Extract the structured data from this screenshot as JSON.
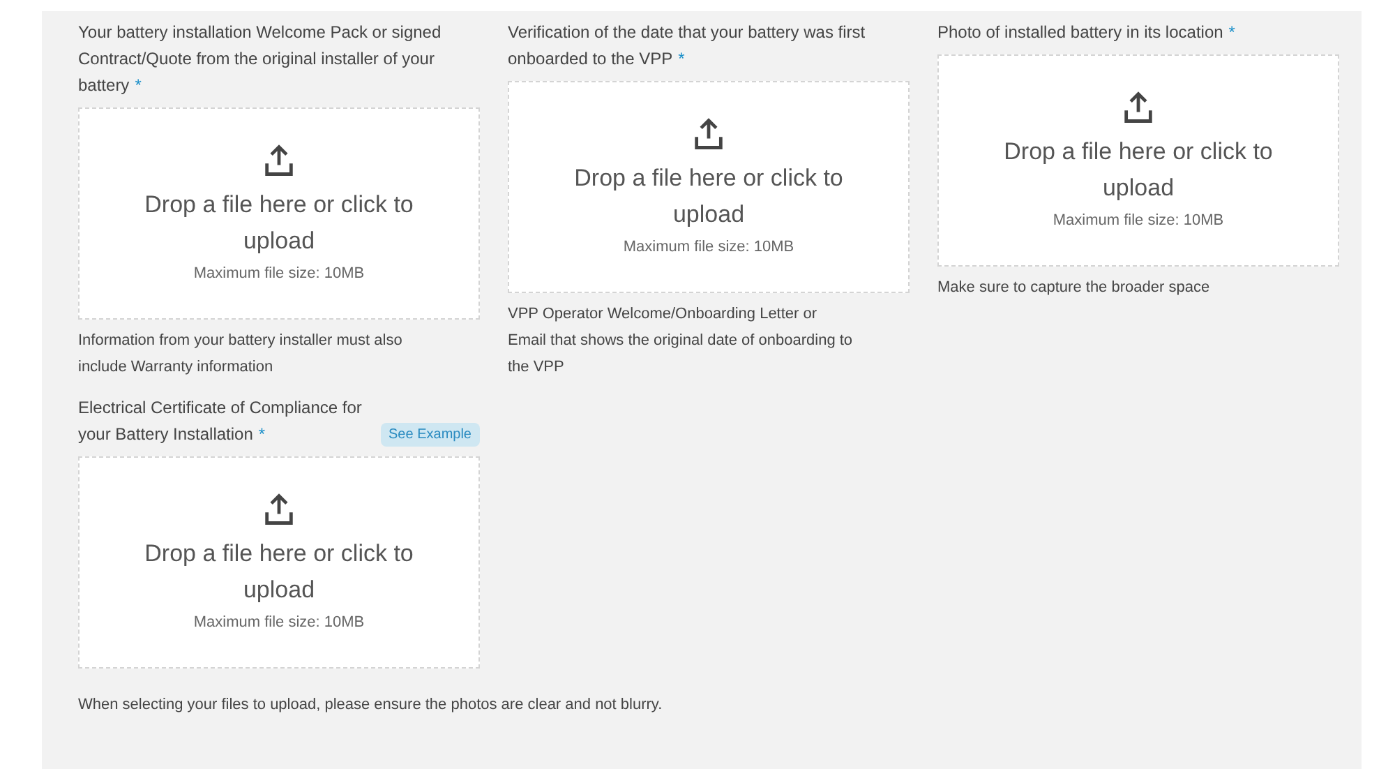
{
  "uploads": [
    {
      "label": "Your battery installation Welcome Pack or signed Contract/Quote from the original installer of your battery",
      "required_mark": "*",
      "drop_text": "Drop a file here or click to upload",
      "max_size": "Maximum file size: 10MB",
      "hint": "Information from your battery installer must also include Warranty information"
    },
    {
      "label": "Verification of the date that your battery was first onboarded to the VPP",
      "required_mark": "*",
      "drop_text": "Drop a file here or click to upload",
      "max_size": "Maximum file size: 10MB",
      "hint": "VPP Operator Welcome/Onboarding Letter or Email that shows the original date of onboarding to the VPP"
    },
    {
      "label": "Photo of installed battery in its location",
      "required_mark": "*",
      "drop_text": "Drop a file here or click to upload",
      "max_size": "Maximum file size: 10MB",
      "hint": "Make sure to capture the broader space"
    },
    {
      "label": "Electrical Certificate of Compliance for your Battery Installation",
      "required_mark": "*",
      "example_link": "See Example",
      "drop_text": "Drop a file here or click to upload",
      "max_size": "Maximum file size: 10MB"
    }
  ],
  "footer_note": "When selecting your files to upload, please ensure the photos are clear and not blurry."
}
